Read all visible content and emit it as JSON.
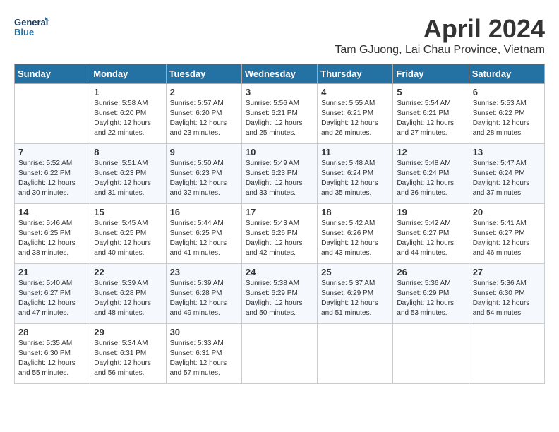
{
  "header": {
    "logo_line1": "General",
    "logo_line2": "Blue",
    "month_title": "April 2024",
    "location": "Tam GJuong, Lai Chau Province, Vietnam"
  },
  "days_of_week": [
    "Sunday",
    "Monday",
    "Tuesday",
    "Wednesday",
    "Thursday",
    "Friday",
    "Saturday"
  ],
  "weeks": [
    [
      {
        "day": "",
        "sunrise": "",
        "sunset": "",
        "daylight": ""
      },
      {
        "day": "1",
        "sunrise": "5:58 AM",
        "sunset": "6:20 PM",
        "daylight": "12 hours and 22 minutes."
      },
      {
        "day": "2",
        "sunrise": "5:57 AM",
        "sunset": "6:20 PM",
        "daylight": "12 hours and 23 minutes."
      },
      {
        "day": "3",
        "sunrise": "5:56 AM",
        "sunset": "6:21 PM",
        "daylight": "12 hours and 25 minutes."
      },
      {
        "day": "4",
        "sunrise": "5:55 AM",
        "sunset": "6:21 PM",
        "daylight": "12 hours and 26 minutes."
      },
      {
        "day": "5",
        "sunrise": "5:54 AM",
        "sunset": "6:21 PM",
        "daylight": "12 hours and 27 minutes."
      },
      {
        "day": "6",
        "sunrise": "5:53 AM",
        "sunset": "6:22 PM",
        "daylight": "12 hours and 28 minutes."
      }
    ],
    [
      {
        "day": "7",
        "sunrise": "5:52 AM",
        "sunset": "6:22 PM",
        "daylight": "12 hours and 30 minutes."
      },
      {
        "day": "8",
        "sunrise": "5:51 AM",
        "sunset": "6:23 PM",
        "daylight": "12 hours and 31 minutes."
      },
      {
        "day": "9",
        "sunrise": "5:50 AM",
        "sunset": "6:23 PM",
        "daylight": "12 hours and 32 minutes."
      },
      {
        "day": "10",
        "sunrise": "5:49 AM",
        "sunset": "6:23 PM",
        "daylight": "12 hours and 33 minutes."
      },
      {
        "day": "11",
        "sunrise": "5:48 AM",
        "sunset": "6:24 PM",
        "daylight": "12 hours and 35 minutes."
      },
      {
        "day": "12",
        "sunrise": "5:48 AM",
        "sunset": "6:24 PM",
        "daylight": "12 hours and 36 minutes."
      },
      {
        "day": "13",
        "sunrise": "5:47 AM",
        "sunset": "6:24 PM",
        "daylight": "12 hours and 37 minutes."
      }
    ],
    [
      {
        "day": "14",
        "sunrise": "5:46 AM",
        "sunset": "6:25 PM",
        "daylight": "12 hours and 38 minutes."
      },
      {
        "day": "15",
        "sunrise": "5:45 AM",
        "sunset": "6:25 PM",
        "daylight": "12 hours and 40 minutes."
      },
      {
        "day": "16",
        "sunrise": "5:44 AM",
        "sunset": "6:25 PM",
        "daylight": "12 hours and 41 minutes."
      },
      {
        "day": "17",
        "sunrise": "5:43 AM",
        "sunset": "6:26 PM",
        "daylight": "12 hours and 42 minutes."
      },
      {
        "day": "18",
        "sunrise": "5:42 AM",
        "sunset": "6:26 PM",
        "daylight": "12 hours and 43 minutes."
      },
      {
        "day": "19",
        "sunrise": "5:42 AM",
        "sunset": "6:27 PM",
        "daylight": "12 hours and 44 minutes."
      },
      {
        "day": "20",
        "sunrise": "5:41 AM",
        "sunset": "6:27 PM",
        "daylight": "12 hours and 46 minutes."
      }
    ],
    [
      {
        "day": "21",
        "sunrise": "5:40 AM",
        "sunset": "6:27 PM",
        "daylight": "12 hours and 47 minutes."
      },
      {
        "day": "22",
        "sunrise": "5:39 AM",
        "sunset": "6:28 PM",
        "daylight": "12 hours and 48 minutes."
      },
      {
        "day": "23",
        "sunrise": "5:39 AM",
        "sunset": "6:28 PM",
        "daylight": "12 hours and 49 minutes."
      },
      {
        "day": "24",
        "sunrise": "5:38 AM",
        "sunset": "6:29 PM",
        "daylight": "12 hours and 50 minutes."
      },
      {
        "day": "25",
        "sunrise": "5:37 AM",
        "sunset": "6:29 PM",
        "daylight": "12 hours and 51 minutes."
      },
      {
        "day": "26",
        "sunrise": "5:36 AM",
        "sunset": "6:29 PM",
        "daylight": "12 hours and 53 minutes."
      },
      {
        "day": "27",
        "sunrise": "5:36 AM",
        "sunset": "6:30 PM",
        "daylight": "12 hours and 54 minutes."
      }
    ],
    [
      {
        "day": "28",
        "sunrise": "5:35 AM",
        "sunset": "6:30 PM",
        "daylight": "12 hours and 55 minutes."
      },
      {
        "day": "29",
        "sunrise": "5:34 AM",
        "sunset": "6:31 PM",
        "daylight": "12 hours and 56 minutes."
      },
      {
        "day": "30",
        "sunrise": "5:33 AM",
        "sunset": "6:31 PM",
        "daylight": "12 hours and 57 minutes."
      },
      {
        "day": "",
        "sunrise": "",
        "sunset": "",
        "daylight": ""
      },
      {
        "day": "",
        "sunrise": "",
        "sunset": "",
        "daylight": ""
      },
      {
        "day": "",
        "sunrise": "",
        "sunset": "",
        "daylight": ""
      },
      {
        "day": "",
        "sunrise": "",
        "sunset": "",
        "daylight": ""
      }
    ]
  ]
}
